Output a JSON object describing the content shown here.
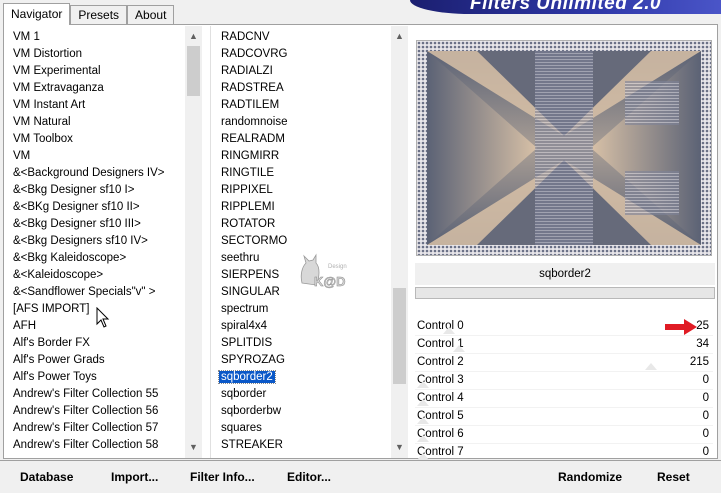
{
  "tabs": [
    {
      "label": "Navigator",
      "active": true
    },
    {
      "label": "Presets",
      "active": false
    },
    {
      "label": "About",
      "active": false
    }
  ],
  "banner": {
    "title": "Filters Unlimited 2.0"
  },
  "categories": {
    "items": [
      "VM 1",
      "VM Distortion",
      "VM Experimental",
      "VM Extravaganza",
      "VM Instant Art",
      "VM Natural",
      "VM Toolbox",
      "VM",
      "&<Background Designers IV>",
      "&<Bkg Designer sf10 I>",
      "&<BKg Designer sf10 II>",
      "&<Bkg Designer sf10 III>",
      "&<Bkg Designers sf10 IV>",
      "&<Bkg Kaleidoscope>",
      "&<Kaleidoscope>",
      "&<Sandflower Specials\"v\" >",
      "[AFS IMPORT]",
      "AFH",
      "Alf's Border FX",
      "Alf's Power Grads",
      "Alf's Power Toys",
      "Andrew's Filter Collection 55",
      "Andrew's Filter Collection 56",
      "Andrew's Filter Collection 57",
      "Andrew's Filter Collection 58"
    ]
  },
  "filters": {
    "items": [
      "RADCNV",
      "RADCOVRG",
      "RADIALZI",
      "RADSTREA",
      "RADTILEM",
      "randomnoise",
      "REALRADM",
      "RINGMIRR",
      "RINGTILE",
      "RIPPIXEL",
      "RIPPLEMI",
      "ROTATOR",
      "SECTORMO",
      "seethru",
      "SIERPENS",
      "SINGULAR",
      "spectrum",
      "spiral4x4",
      "SPLITDIS",
      "SPYROZAG",
      "sqborder2",
      "sqborder",
      "sqborderbw",
      "squares",
      "STREAKER"
    ],
    "selected_index": 20
  },
  "preview": {
    "filter_name": "sqborder2",
    "colors": {
      "slate": "#5b6275",
      "beige": "#d8c1a7",
      "border": "#8a8fa3"
    }
  },
  "controls": [
    {
      "label": "Control 0",
      "value": "25"
    },
    {
      "label": "Control 1",
      "value": "34"
    },
    {
      "label": "Control 2",
      "value": "215"
    },
    {
      "label": "Control 3",
      "value": "0"
    },
    {
      "label": "Control 4",
      "value": "0"
    },
    {
      "label": "Control 5",
      "value": "0"
    },
    {
      "label": "Control 6",
      "value": "0"
    },
    {
      "label": "Control 7",
      "value": "0"
    }
  ],
  "watermark": {
    "text": "K@D",
    "small": "Design"
  },
  "buttons": {
    "database": "Database",
    "import": "Import...",
    "filter_info": "Filter Info...",
    "editor": "Editor...",
    "randomize": "Randomize",
    "reset": "Reset"
  },
  "accent": {
    "selection": "#0a58c8",
    "annotation_arrow": "#e01b24",
    "banner": "#2f38a8"
  }
}
